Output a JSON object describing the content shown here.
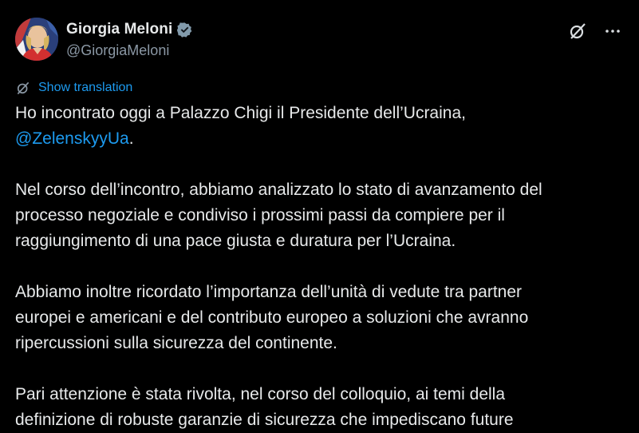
{
  "author": {
    "display_name": "Giorgia Meloni",
    "handle": "@GiorgiaMeloni",
    "verified_icon": "verified-badge-icon",
    "avatar_icon": "avatar"
  },
  "actions": {
    "grok_icon": "grok-icon",
    "more_icon": "more-icon"
  },
  "translate": {
    "label": "Show translation",
    "icon": "translate-icon"
  },
  "tweet": {
    "p1": {
      "line1": "Ho incontrato oggi a Palazzo Chigi il Presidente dell’Ucraina,",
      "mention": "@ZelenskyyUa",
      "after_mention": "."
    },
    "p2": {
      "line1": "Nel corso dell’incontro, abbiamo analizzato lo stato di avanzamento del",
      "line2": "processo negoziale e condiviso i prossimi passi da compiere per il",
      "line3": "raggiungimento di una pace giusta e duratura per l’Ucraina."
    },
    "p3": {
      "line1": "Abbiamo inoltre ricordato l’importanza dell’unità di vedute tra partner",
      "line2": "europei e americani e del contributo europeo a soluzioni che avranno",
      "line3": "ripercussioni sulla sicurezza del continente."
    },
    "p4": {
      "line1": "Pari attenzione è stata rivolta, nel corso del colloquio, ai temi della",
      "line2": "definizione di robuste garanzie di sicurezza che impediscano future"
    }
  },
  "colors": {
    "background": "#000000",
    "text": "#e7e9ea",
    "secondary": "#8b98a5",
    "link": "#1d9bf0"
  }
}
